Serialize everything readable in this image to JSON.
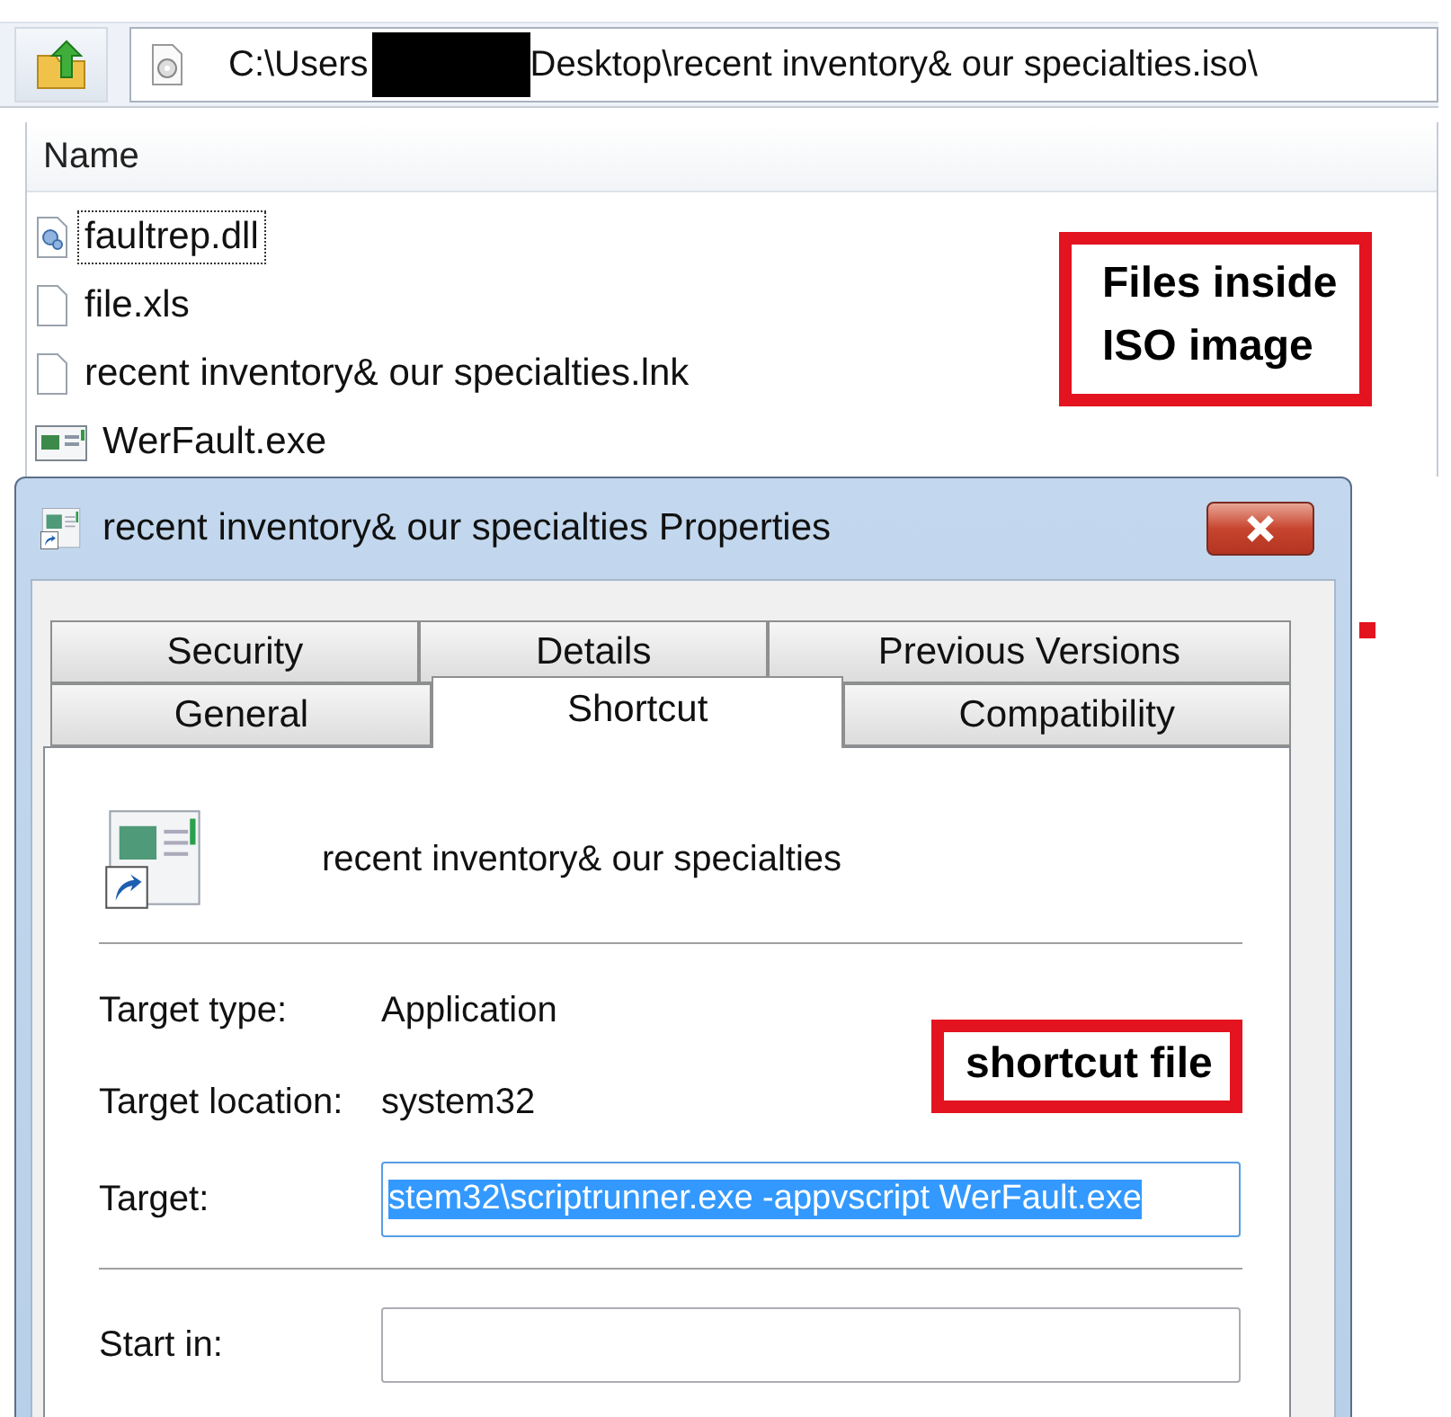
{
  "explorer": {
    "address_bar": {
      "path_start": "C:\\Users",
      "path_end": "Desktop\\recent inventory& our specialties.iso\\"
    },
    "columns": [
      "Name"
    ],
    "files": [
      {
        "name": "faultrep.dll",
        "kind": "dll",
        "focused": true
      },
      {
        "name": "file.xls",
        "kind": "blank",
        "focused": false
      },
      {
        "name": "recent inventory& our specialties.lnk",
        "kind": "blank",
        "focused": false
      },
      {
        "name": "WerFault.exe",
        "kind": "exe",
        "focused": false
      }
    ]
  },
  "dialog": {
    "title": "recent inventory& our specialties Properties",
    "tab_rows": [
      [
        {
          "label": "Security",
          "selected": false
        },
        {
          "label": "Details",
          "selected": false
        },
        {
          "label": "Previous Versions",
          "selected": false
        }
      ],
      [
        {
          "label": "General",
          "selected": false
        },
        {
          "label": "Shortcut",
          "selected": true
        },
        {
          "label": "Compatibility",
          "selected": false
        }
      ]
    ],
    "shortcut_name": "recent inventory& our specialties",
    "sections": [
      [
        {
          "kind": "text",
          "label": "Target type:",
          "value": "Application"
        },
        {
          "kind": "text",
          "label": "Target location:",
          "value": "system32"
        },
        {
          "kind": "input",
          "label": "Target:",
          "value": "stem32\\scriptrunner.exe -appvscript WerFault.exe",
          "selected": true
        }
      ],
      [
        {
          "kind": "input",
          "label": "Start in:"
        }
      ]
    ]
  },
  "annotations": [
    {
      "text": "Files inside\nISO image"
    },
    {
      "text": "shortcut file"
    }
  ]
}
